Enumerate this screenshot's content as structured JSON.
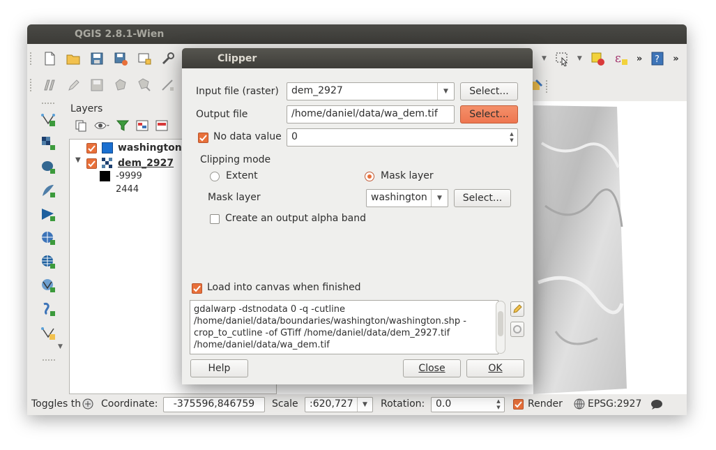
{
  "window": {
    "title": "QGIS 2.8.1-Wien"
  },
  "toolbar1": {
    "icons": [
      "new-project-icon",
      "open-project-icon",
      "save-project-icon",
      "save-as-icon",
      "new-print-composer-icon",
      "composer-manager-icon"
    ],
    "right_icons": [
      "select-features-icon",
      "deselect-icon",
      "expression-select-icon",
      "whats-this-icon"
    ],
    "overflow": "»"
  },
  "toolbar2": {
    "icons": [
      "digitize-icon",
      "toggle-edit-icon",
      "save-edits-icon",
      "add-feature-icon",
      "move-feature-icon",
      "node-tool-icon"
    ]
  },
  "left_toolbar": {
    "icons": [
      "add-vector-layer-icon",
      "add-raster-layer-icon",
      "add-postgis-layer-icon",
      "add-spatialite-layer-icon",
      "add-mssql-layer-icon",
      "add-wms-layer-icon",
      "add-wcs-layer-icon",
      "add-wfs-layer-icon",
      "add-delimited-text-icon",
      "add-virtual-layer-icon"
    ]
  },
  "layers_panel": {
    "title": "Layers",
    "layers": [
      {
        "name": "washington",
        "checked": true,
        "color": "#1a6fd0"
      },
      {
        "name": "dem_2927",
        "checked": true,
        "expanded": true
      }
    ],
    "legend": [
      {
        "label": "-9999",
        "color": "#000000"
      },
      {
        "label": "2444",
        "color": "#ffffff"
      }
    ]
  },
  "statusbar": {
    "toggles_text": "Toggles th",
    "coordinate_label": "Coordinate:",
    "coordinate_value": "-375596,846759",
    "scale_label": "Scale",
    "scale_value": ":620,727",
    "rotation_label": "Rotation:",
    "rotation_value": "0.0",
    "render_label": "Render",
    "render_checked": true,
    "crs_label": "EPSG:2927"
  },
  "dialog": {
    "title": "Clipper",
    "input_label": "Input file (raster)",
    "input_value": "dem_2927",
    "input_button": "Select...",
    "output_label": "Output file",
    "output_value": "/home/daniel/data/wa_dem.tif",
    "output_button": "Select...",
    "nodata_label": "No data value",
    "nodata_checked": true,
    "nodata_value": "0",
    "clipping_mode_label": "Clipping mode",
    "extent_label": "Extent",
    "mask_layer_radio_label": "Mask layer",
    "mask_layer_selected": true,
    "mask_layer_label": "Mask layer",
    "mask_layer_value": "washington",
    "mask_layer_button": "Select...",
    "alpha_label": "Create an output alpha band",
    "alpha_checked": false,
    "load_label": "Load into canvas when finished",
    "load_checked": true,
    "command_text": "gdalwarp -dstnodata 0 -q -cutline\n/home/daniel/data/boundaries/washington/washington.shp -\ncrop_to_cutline -of GTiff /home/daniel/data/dem_2927.tif\n/home/daniel/data/wa_dem.tif",
    "help_button": "Help",
    "close_button": "Close",
    "ok_button": "OK"
  },
  "colors": {
    "accent": "#e8703a",
    "titlebar": "#3c3b37",
    "window_bg": "#ecebe9"
  }
}
